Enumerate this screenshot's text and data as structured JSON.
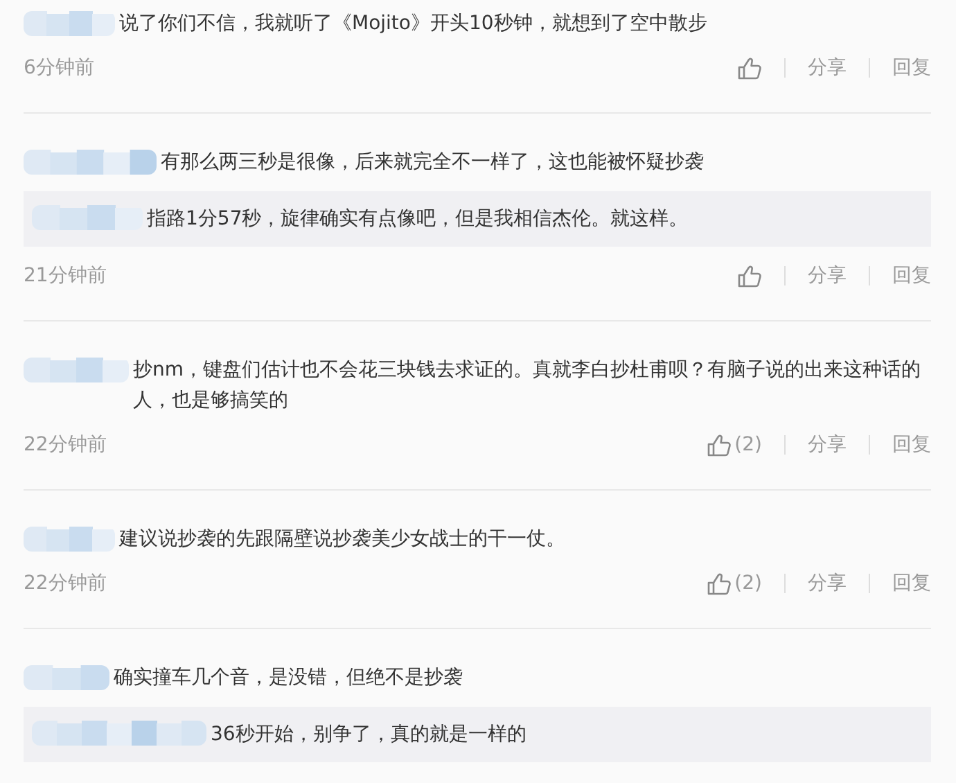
{
  "comments": [
    {
      "text": "说了你们不信，我就听了《Mojito》开头10秒钟，就想到了空中散步",
      "time": "6分钟前",
      "share": "分享",
      "reply_label": "回复"
    },
    {
      "text": "有那么两三秒是很像，后来就完全不一样了，这也能被怀疑抄袭",
      "reply": {
        "text": "指路1分57秒，旋律确实有点像吧，但是我相信杰伦。就这样。"
      },
      "time": "21分钟前",
      "share": "分享",
      "reply_label": "回复"
    },
    {
      "text": "抄nm，键盘们估计也不会花三块钱去求证的。真就李白抄杜甫呗？有脑子说的出来这种话的人，也是够搞笑的",
      "time": "22分钟前",
      "likes": "(2)",
      "share": "分享",
      "reply_label": "回复"
    },
    {
      "text": "建议说抄袭的先跟隔壁说抄袭美少女战士的干一仗。",
      "time": "22分钟前",
      "likes": "(2)",
      "share": "分享",
      "reply_label": "回复"
    },
    {
      "text": "确实撞车几个音，是没错，但绝不是抄袭",
      "reply": {
        "text": "36秒开始，别争了，真的就是一样的"
      }
    }
  ]
}
